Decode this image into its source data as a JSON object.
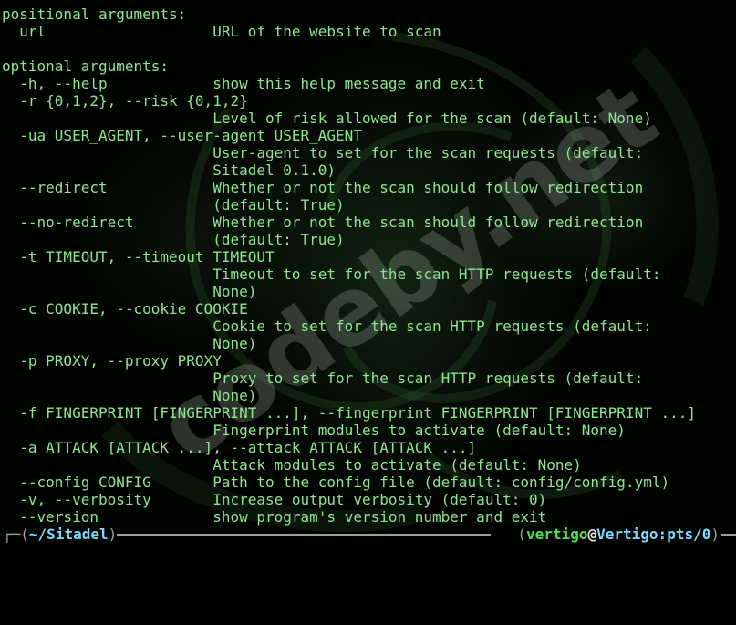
{
  "watermark": "codeby.net",
  "help": {
    "positional_header": "positional arguments:",
    "positional": [
      {
        "opt": "url",
        "desc": "URL of the website to scan"
      }
    ],
    "optional_header": "optional arguments:",
    "optional": [
      {
        "opt": "-h, --help",
        "desc": [
          "show this help message and exit"
        ]
      },
      {
        "opt": "-r {0,1,2}, --risk {0,1,2}",
        "desc": [
          "Level of risk allowed for the scan (default: None)"
        ]
      },
      {
        "opt": "-ua USER_AGENT, --user-agent USER_AGENT",
        "desc": [
          "User-agent to set for the scan requests (default:",
          "Sitadel 0.1.0)"
        ]
      },
      {
        "opt": "--redirect",
        "desc": [
          "Whether or not the scan should follow redirection",
          "(default: True)"
        ]
      },
      {
        "opt": "--no-redirect",
        "desc": [
          "Whether or not the scan should follow redirection",
          "(default: True)"
        ]
      },
      {
        "opt": "-t TIMEOUT, --timeout TIMEOUT",
        "desc": [
          "Timeout to set for the scan HTTP requests (default:",
          "None)"
        ]
      },
      {
        "opt": "-c COOKIE, --cookie COOKIE",
        "desc": [
          "Cookie to set for the scan HTTP requests (default:",
          "None)"
        ]
      },
      {
        "opt": "-p PROXY, --proxy PROXY",
        "desc": [
          "Proxy to set for the scan HTTP requests (default:",
          "None)"
        ]
      },
      {
        "opt": "-f FINGERPRINT [FINGERPRINT ...], --fingerprint FINGERPRINT [FINGERPRINT ...]",
        "desc": [
          "Fingerprint modules to activate (default: None)"
        ]
      },
      {
        "opt": "-a ATTACK [ATTACK ...], --attack ATTACK [ATTACK ...]",
        "desc": [
          "Attack modules to activate (default: None)"
        ]
      },
      {
        "opt": "--config CONFIG",
        "desc": [
          "Path to the config file (default: config/config.yml)"
        ]
      },
      {
        "opt": "-v, --verbosity",
        "desc": [
          "Increase output verbosity (default: 0)"
        ]
      },
      {
        "opt": "--version",
        "desc": [
          "show program's version number and exit"
        ]
      }
    ]
  },
  "prompt": {
    "directory": "~/Sitadel",
    "user": "vertigo",
    "at": "@",
    "host": "Vertigo:pts/0"
  },
  "colors": {
    "text": "#8ee68e",
    "background": "#020402",
    "directory": "#7fd9ff",
    "user": "#4fe04f",
    "rule": "#9aa19a"
  }
}
